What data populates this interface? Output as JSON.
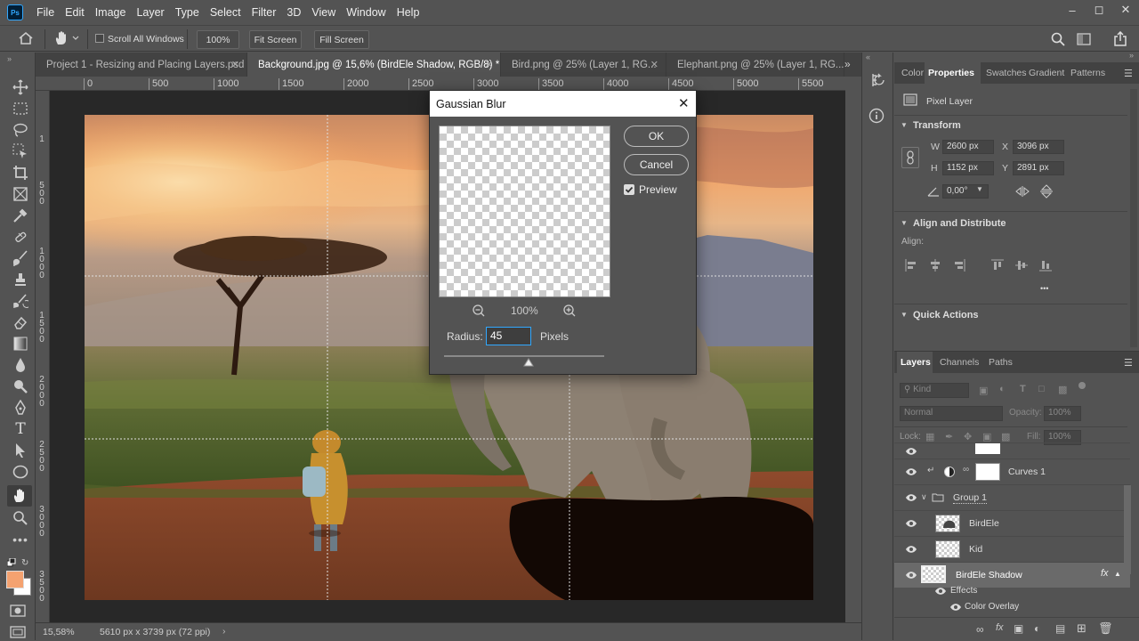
{
  "app": {
    "logo": "Ps"
  },
  "menu": [
    "File",
    "Edit",
    "Image",
    "Layer",
    "Type",
    "Select",
    "Filter",
    "3D",
    "View",
    "Window",
    "Help"
  ],
  "options": {
    "scroll_all_windows": "Scroll All Windows",
    "zoom": "100%",
    "fit_screen": "Fit Screen",
    "fill_screen": "Fill Screen"
  },
  "tabs": [
    {
      "label": "Project 1 - Resizing and Placing Layers.psd",
      "active": false
    },
    {
      "label": "Background.jpg @ 15,6% (BirdEle Shadow, RGB/8) *",
      "active": true
    },
    {
      "label": "Bird.png @ 25% (Layer 1, RG...",
      "active": false
    },
    {
      "label": "Elephant.png @ 25% (Layer 1, RG...",
      "active": false
    }
  ],
  "ruler": {
    "h_ticks": [
      "0",
      "500",
      "1000",
      "1500",
      "2000",
      "2500",
      "3000",
      "3500",
      "4000",
      "4500",
      "5000",
      "5500"
    ],
    "v_ticks": [
      "1",
      "5",
      "0",
      "0",
      "1",
      "0",
      "0",
      "0",
      "1",
      "5",
      "0",
      "0",
      "2",
      "0",
      "0",
      "0",
      "2",
      "5",
      "0",
      "0",
      "3",
      "0",
      "0",
      "0",
      "3",
      "5",
      "0",
      "0"
    ]
  },
  "status": {
    "zoom": "15,58%",
    "doc_size": "5610 px x 3739 px (72 ppi)"
  },
  "dialog": {
    "title": "Gaussian Blur",
    "ok": "OK",
    "cancel": "Cancel",
    "preview_label": "Preview",
    "preview_checked": true,
    "zoom": "100%",
    "radius_label": "Radius:",
    "radius_value": "45",
    "unit": "Pixels",
    "slider_fraction": 0.53
  },
  "properties": {
    "tabs": [
      "Color",
      "Properties",
      "Swatches",
      "Gradient",
      "Patterns"
    ],
    "layer_type": "Pixel Layer",
    "transform_title": "Transform",
    "w_label": "W",
    "w": "2600 px",
    "h_label": "H",
    "h": "1152 px",
    "x_label": "X",
    "x": "3096 px",
    "y_label": "Y",
    "y": "2891 px",
    "angle": "0,00°",
    "align_title": "Align and Distribute",
    "align_label": "Align:",
    "more": "•••",
    "quick_actions": "Quick Actions"
  },
  "layers_panel": {
    "tabs": [
      "Layers",
      "Channels",
      "Paths"
    ],
    "kind": "Kind",
    "blend_mode": "Normal",
    "opacity_label": "Opacity:",
    "opacity": "100%",
    "lock_label": "Lock:",
    "fill_label": "Fill:",
    "fill": "100%",
    "rows": [
      {
        "name": "Curves 1",
        "type": "adjustment"
      },
      {
        "name": "Group 1",
        "type": "group"
      },
      {
        "name": "BirdEle",
        "type": "pixel"
      },
      {
        "name": "Kid",
        "type": "pixel"
      },
      {
        "name": "BirdEle Shadow",
        "type": "pixel",
        "selected": true
      }
    ],
    "effects_label": "Effects",
    "effect": "Color Overlay",
    "fx": "fx"
  },
  "colors": {
    "accent": "#31a8ff",
    "foreground": "#f4a270",
    "background": "#ffffff"
  }
}
